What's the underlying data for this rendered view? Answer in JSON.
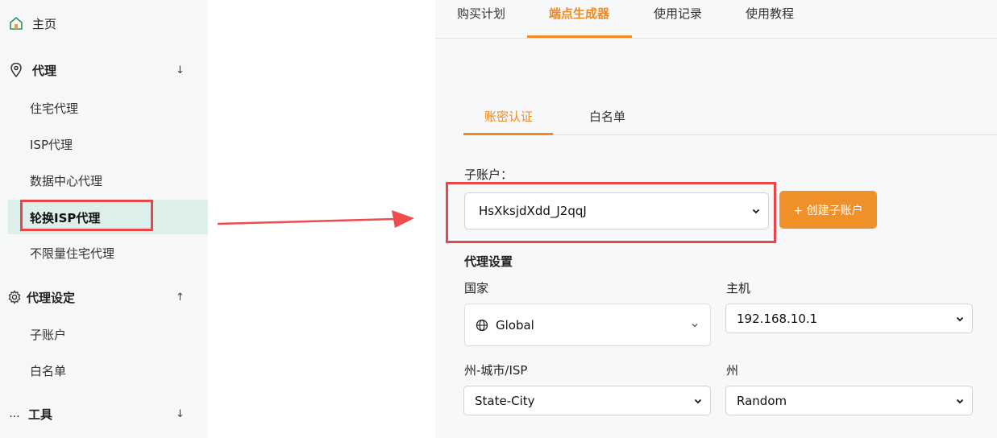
{
  "sidebar": {
    "home": {
      "label": "主页",
      "icon": "home-icon"
    },
    "proxy": {
      "label": "代理",
      "icon": "location-pin-icon",
      "expand": "↓"
    },
    "proxy_items": [
      "住宅代理",
      "ISP代理",
      "数据中心代理",
      "轮换ISP代理",
      "不限量住宅代理"
    ],
    "settings": {
      "label": "代理设定",
      "icon": "gear-icon",
      "expand": "↑"
    },
    "settings_items": [
      "子账户",
      "白名单"
    ],
    "tools": {
      "label": "工具",
      "icon": "ellipsis-icon",
      "icon_text": "...",
      "expand": "↓"
    }
  },
  "top_tabs": [
    "购买计划",
    "端点生成器",
    "使用记录",
    "使用教程"
  ],
  "sub_tabs": [
    "账密认证",
    "白名单"
  ],
  "form": {
    "sub_account_label": "子账户：",
    "sub_account_value": "HsXksjdXdd_J2qqJ",
    "create_button": "+ 创建子账户",
    "proxy_settings_label": "代理设置",
    "country_label": "国家",
    "country_value": "Global",
    "host_label": "主机",
    "host_value": "192.168.10.1",
    "state_city_isp_label": "州-城市/ISP",
    "state_city_isp_value": "State-City",
    "state_label": "州",
    "state_value": "Random"
  },
  "colors": {
    "accent": "#ef8a22",
    "highlight": "#e8454a",
    "active_bg": "#dcefeb"
  }
}
